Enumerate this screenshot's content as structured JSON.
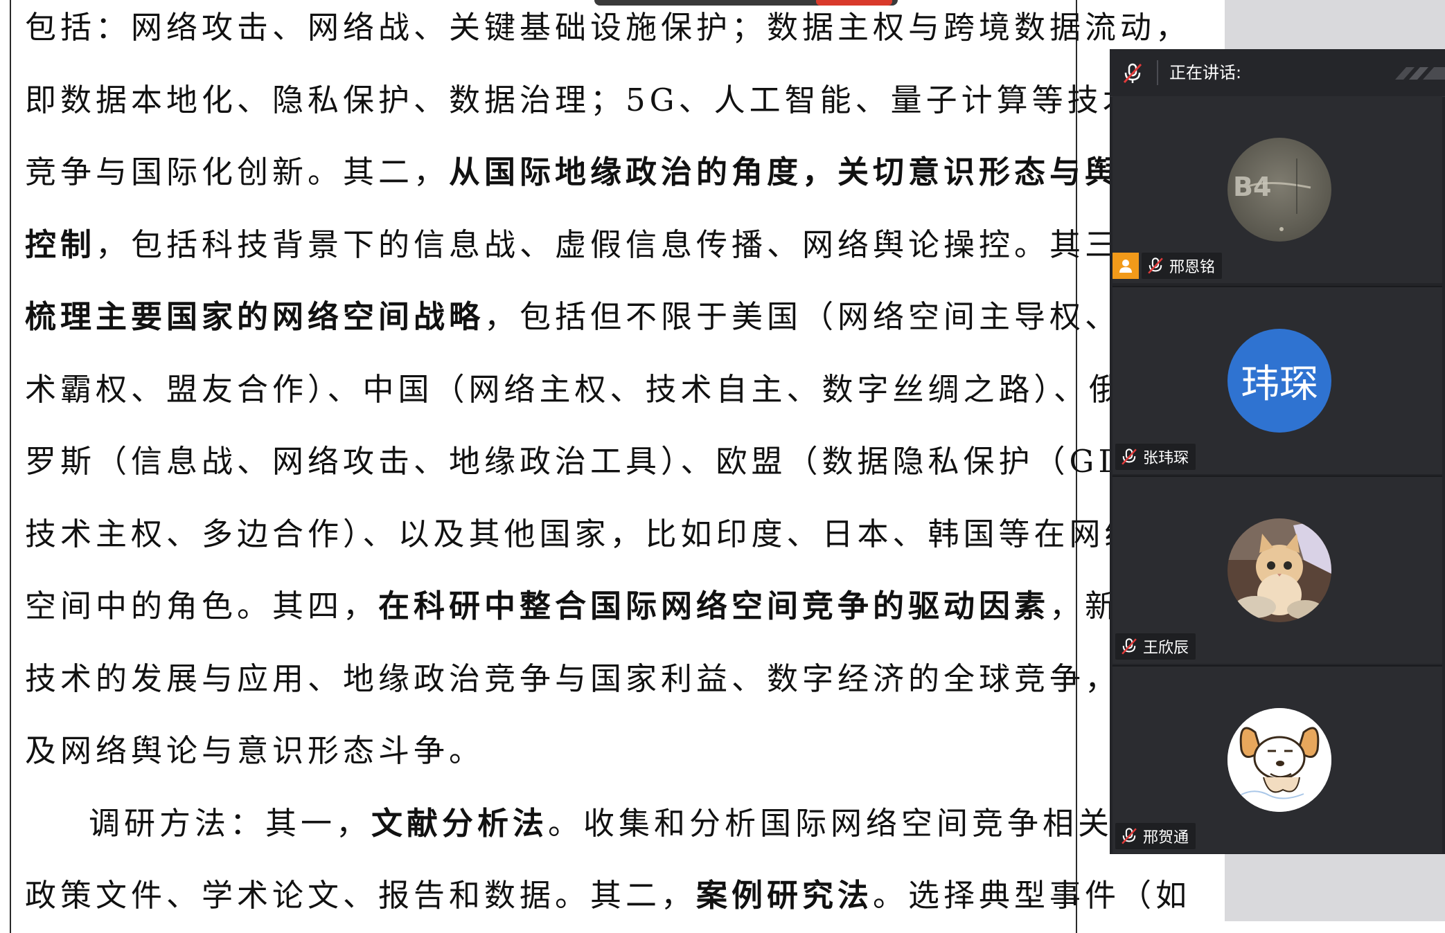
{
  "document": {
    "lines": [
      [
        {
          "t": "包括：网络攻击、网络战、关键基础设施保护；数据主权与跨境数据流动，"
        }
      ],
      [
        {
          "t": "即数据本地化、隐私保护、数据治理；5G、人工智能、量子计算等技术的"
        }
      ],
      [
        {
          "t": "竞争与国际化创新。其二，"
        },
        {
          "t": "从国际地缘政治的角度，关切意识形态与舆论",
          "b": true
        }
      ],
      [
        {
          "t": "控制",
          "b": true
        },
        {
          "t": "，包括科技背景下的信息战、虚假信息传播、网络舆论操控。其三，"
        }
      ],
      [
        {
          "t": "梳理主要国家的网络空间战略",
          "b": true
        },
        {
          "t": "，包括但不限于美国（网络空间主导权、技"
        }
      ],
      [
        {
          "t": "术霸权、盟友合作）、中国（网络主权、技术自主、数字丝绸之路）、俄"
        }
      ],
      [
        {
          "t": "罗斯（信息战、网络攻击、地缘政治工具）、欧盟（数据隐私保护（GDPR）、"
        }
      ],
      [
        {
          "t": "技术主权、多边合作）、以及其他国家，比如印度、日本、韩国等在网络"
        }
      ],
      [
        {
          "t": "空间中的角色。其四，"
        },
        {
          "t": "在科研中整合国际网络空间竞争的驱动因素",
          "b": true
        },
        {
          "t": "，新兴"
        }
      ],
      [
        {
          "t": "技术的发展与应用、地缘政治竞争与国家利益、数字经济的全球竞争，以"
        }
      ],
      [
        {
          "t": "及网络舆论与意识形态斗争。"
        }
      ],
      [
        {
          "t": "调研方法：其一，"
        },
        {
          "t": "文献分析法",
          "b": true
        },
        {
          "t": "。收集和分析国际网络空间竞争相关的"
        }
      ],
      [
        {
          "t": "政策文件、学术论文、报告和数据。其二，"
        },
        {
          "t": "案例研究法",
          "b": true
        },
        {
          "t": "。选择典型事件（如"
        }
      ]
    ]
  },
  "meeting": {
    "speaking_label": "正在讲话:",
    "participants": [
      {
        "name": "邢恩铭",
        "avatar": "photo-avatar",
        "avatar_text": "B4",
        "host": true,
        "muted": true
      },
      {
        "name": "张玮琛",
        "avatar": "text-avatar",
        "avatar_text": "玮琛",
        "host": false,
        "muted": true
      },
      {
        "name": "王欣辰",
        "avatar": "cat-photo-avatar",
        "host": false,
        "muted": true
      },
      {
        "name": "邢贺通",
        "avatar": "cartoon-dog-avatar",
        "host": false,
        "muted": true
      }
    ]
  },
  "colors": {
    "panel_bg": "#232428",
    "host_badge": "#f29a1a",
    "text_avatar_bg": "#2f73d1",
    "muted_red": "#e23b3b"
  }
}
